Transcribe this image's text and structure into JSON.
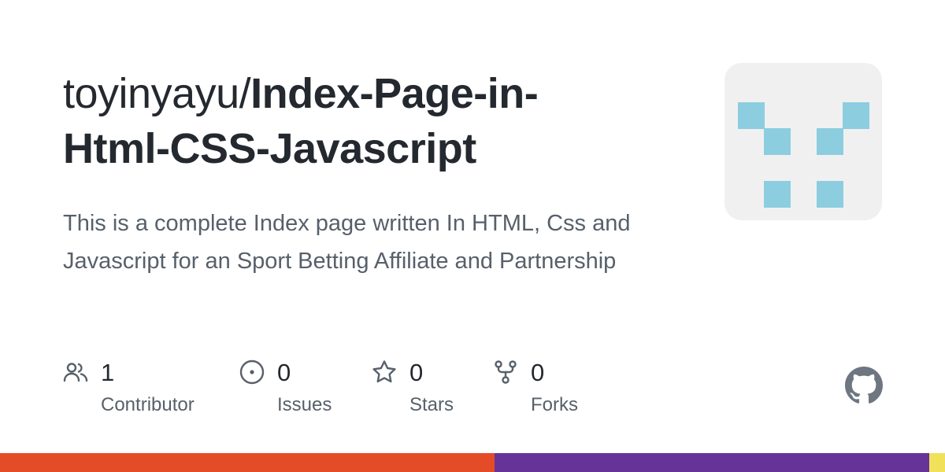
{
  "repo": {
    "owner": "toyinyayu/",
    "name_line1": "Index-Page-in-",
    "name_line2": "Html-CSS-Javascript",
    "description": "This is a complete Index page written In HTML, Css and Javascript for an Sport Betting Affiliate and Partnership"
  },
  "stats": [
    {
      "icon": "contributors-icon",
      "count": "1",
      "label": "Contributor"
    },
    {
      "icon": "issues-icon",
      "count": "0",
      "label": "Issues"
    },
    {
      "icon": "star-icon",
      "count": "0",
      "label": "Stars"
    },
    {
      "icon": "fork-icon",
      "count": "0",
      "label": "Forks"
    }
  ],
  "avatar": {
    "icon": "identicon-avatar",
    "color": "#8ccde0",
    "background": "#f0f0f0"
  },
  "branding": {
    "icon": "github-mark-icon",
    "color": "#6e7781"
  },
  "languages": [
    {
      "color": "#e34c26",
      "share": 0.523
    },
    {
      "color": "#663399",
      "share": 0.46
    },
    {
      "color": "#f1e05a",
      "share": 0.017
    }
  ]
}
